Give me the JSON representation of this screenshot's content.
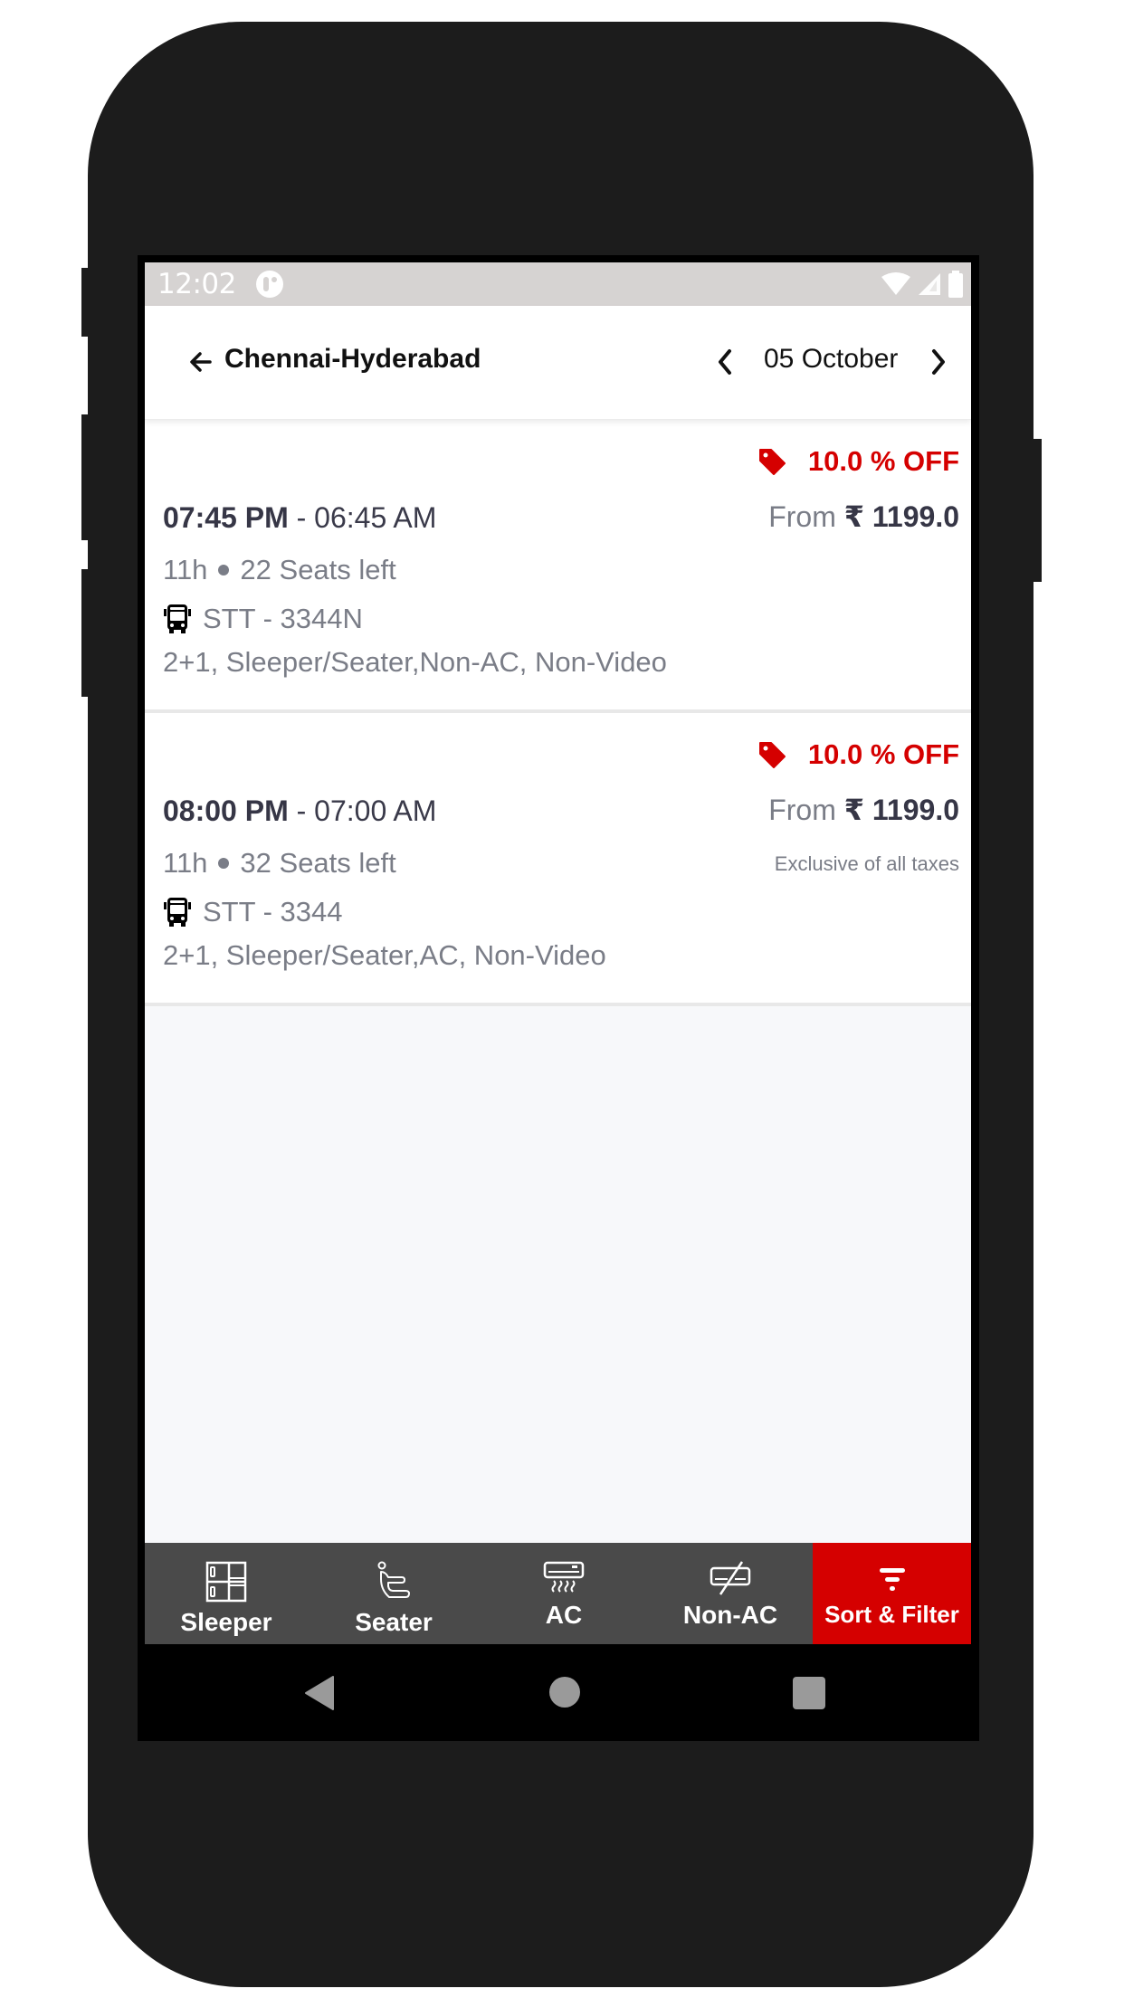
{
  "status_bar": {
    "time": "12:02",
    "icons": [
      "app-notification-icon",
      "wifi-icon",
      "cellular-signal-icon",
      "battery-icon"
    ]
  },
  "header": {
    "back_icon": "arrow-left-icon",
    "route": "Chennai-Hyderabad",
    "prev_date_icon": "chevron-left-icon",
    "date": "05 October",
    "next_date_icon": "chevron-right-icon"
  },
  "buses": [
    {
      "discount": "10.0 % OFF",
      "departure": "07:45 PM",
      "arrival_sep": " - ",
      "arrival": "06:45 AM",
      "price_prefix": "From ",
      "price": "₹ 1199.0",
      "tax_note": "",
      "duration": "11h",
      "seats_left": "22 Seats left",
      "bus_name": "STT - 3344N",
      "features": "2+1, Sleeper/Seater,Non-AC, Non-Video"
    },
    {
      "discount": "10.0 % OFF",
      "departure": "08:00 PM",
      "arrival_sep": " - ",
      "arrival": "07:00 AM",
      "price_prefix": "From ",
      "price": "₹ 1199.0",
      "tax_note": "Exclusive of all taxes",
      "duration": "11h",
      "seats_left": "32 Seats left",
      "bus_name": "STT - 3344",
      "features": "2+1, Sleeper/Seater,AC, Non-Video"
    }
  ],
  "bottom_nav": {
    "items": [
      {
        "label": "Sleeper",
        "icon": "sleeper-berth-icon",
        "active": false
      },
      {
        "label": "Seater",
        "icon": "seat-icon",
        "active": false
      },
      {
        "label": "AC",
        "icon": "air-conditioner-icon",
        "active": false
      },
      {
        "label": "Non-AC",
        "icon": "no-ac-icon",
        "active": false
      },
      {
        "label": "Sort & Filter",
        "icon": "filter-icon",
        "active": true
      }
    ]
  },
  "colors": {
    "accent": "#d50000",
    "nav_bg": "#4a4a4a",
    "text_primary": "#363646",
    "text_secondary": "#7a7d87",
    "status_bar": "#d6d3d2"
  }
}
